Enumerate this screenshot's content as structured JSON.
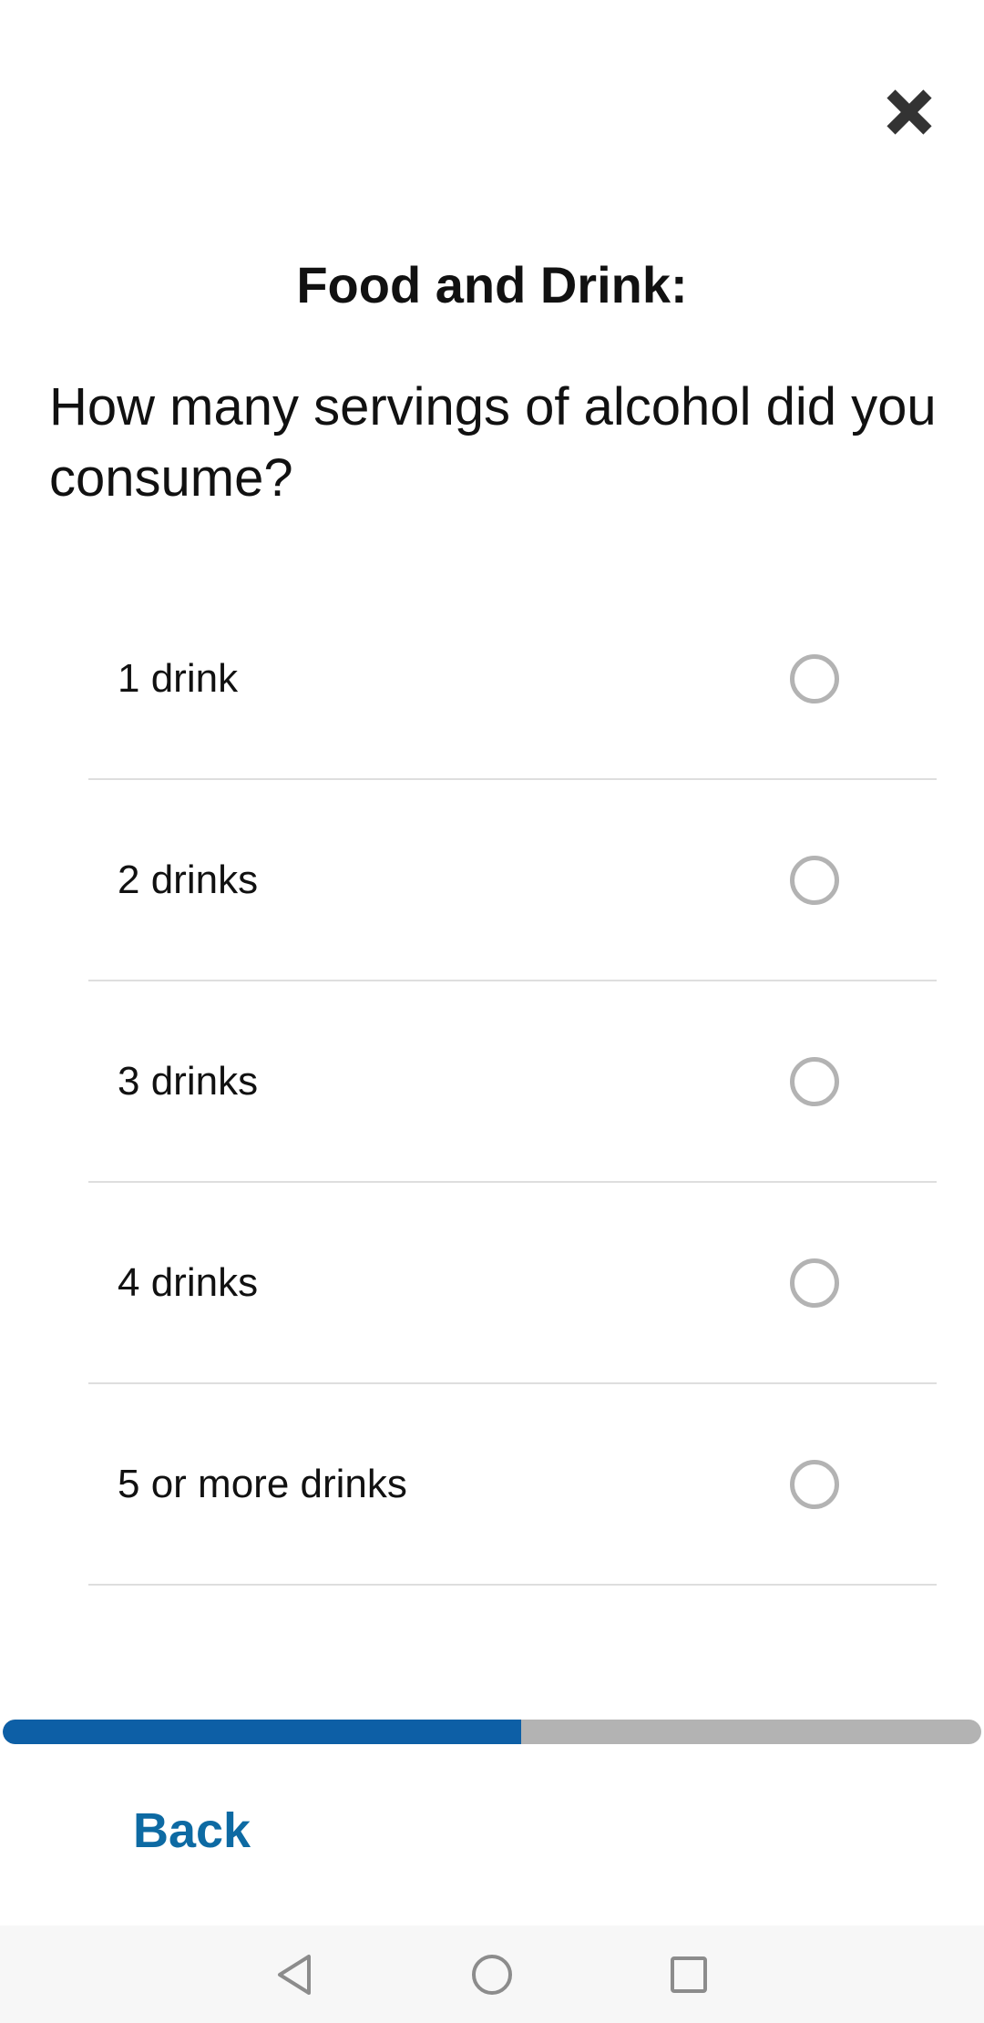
{
  "header": {
    "title": "Food and Drink:",
    "close_icon": "close-icon"
  },
  "question": {
    "text": "How many servings of alcohol did you consume?"
  },
  "options": [
    {
      "label": "1 drink",
      "selected": false
    },
    {
      "label": "2 drinks",
      "selected": false
    },
    {
      "label": "3 drinks",
      "selected": false
    },
    {
      "label": "4 drinks",
      "selected": false
    },
    {
      "label": "5 or more drinks",
      "selected": false
    }
  ],
  "progress": {
    "fraction": 0.53,
    "fill_color": "#0d5fa6",
    "track_color": "#b3b3b3"
  },
  "footer": {
    "back_label": "Back",
    "back_color": "#0d6aa3"
  },
  "navbar": {
    "icons": [
      "back-triangle-icon",
      "home-circle-icon",
      "recents-square-icon"
    ]
  }
}
